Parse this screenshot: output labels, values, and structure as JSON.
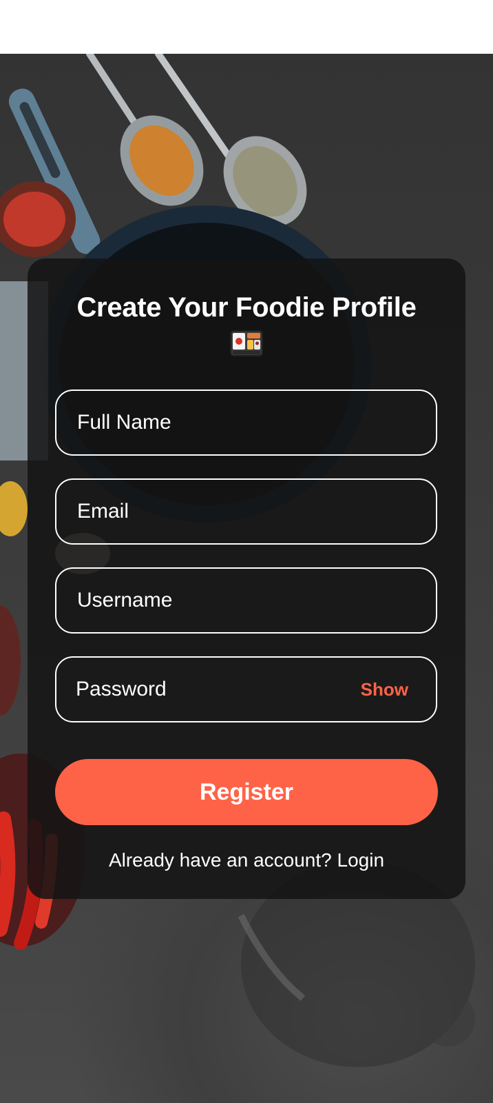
{
  "title": {
    "text": "Create Your Foodie Profile",
    "icon": "bento-box-icon"
  },
  "form": {
    "full_name": {
      "placeholder": "Full Name",
      "value": ""
    },
    "email": {
      "placeholder": "Email",
      "value": ""
    },
    "username": {
      "placeholder": "Username",
      "value": ""
    },
    "password": {
      "placeholder": "Password",
      "value": "",
      "toggle_label": "Show"
    },
    "register_label": "Register"
  },
  "login_prompt": {
    "text": "Already have an account?",
    "link_label": "Login"
  },
  "colors": {
    "accent": "#ff6347",
    "card_background": "#141414",
    "text": "#ffffff"
  }
}
